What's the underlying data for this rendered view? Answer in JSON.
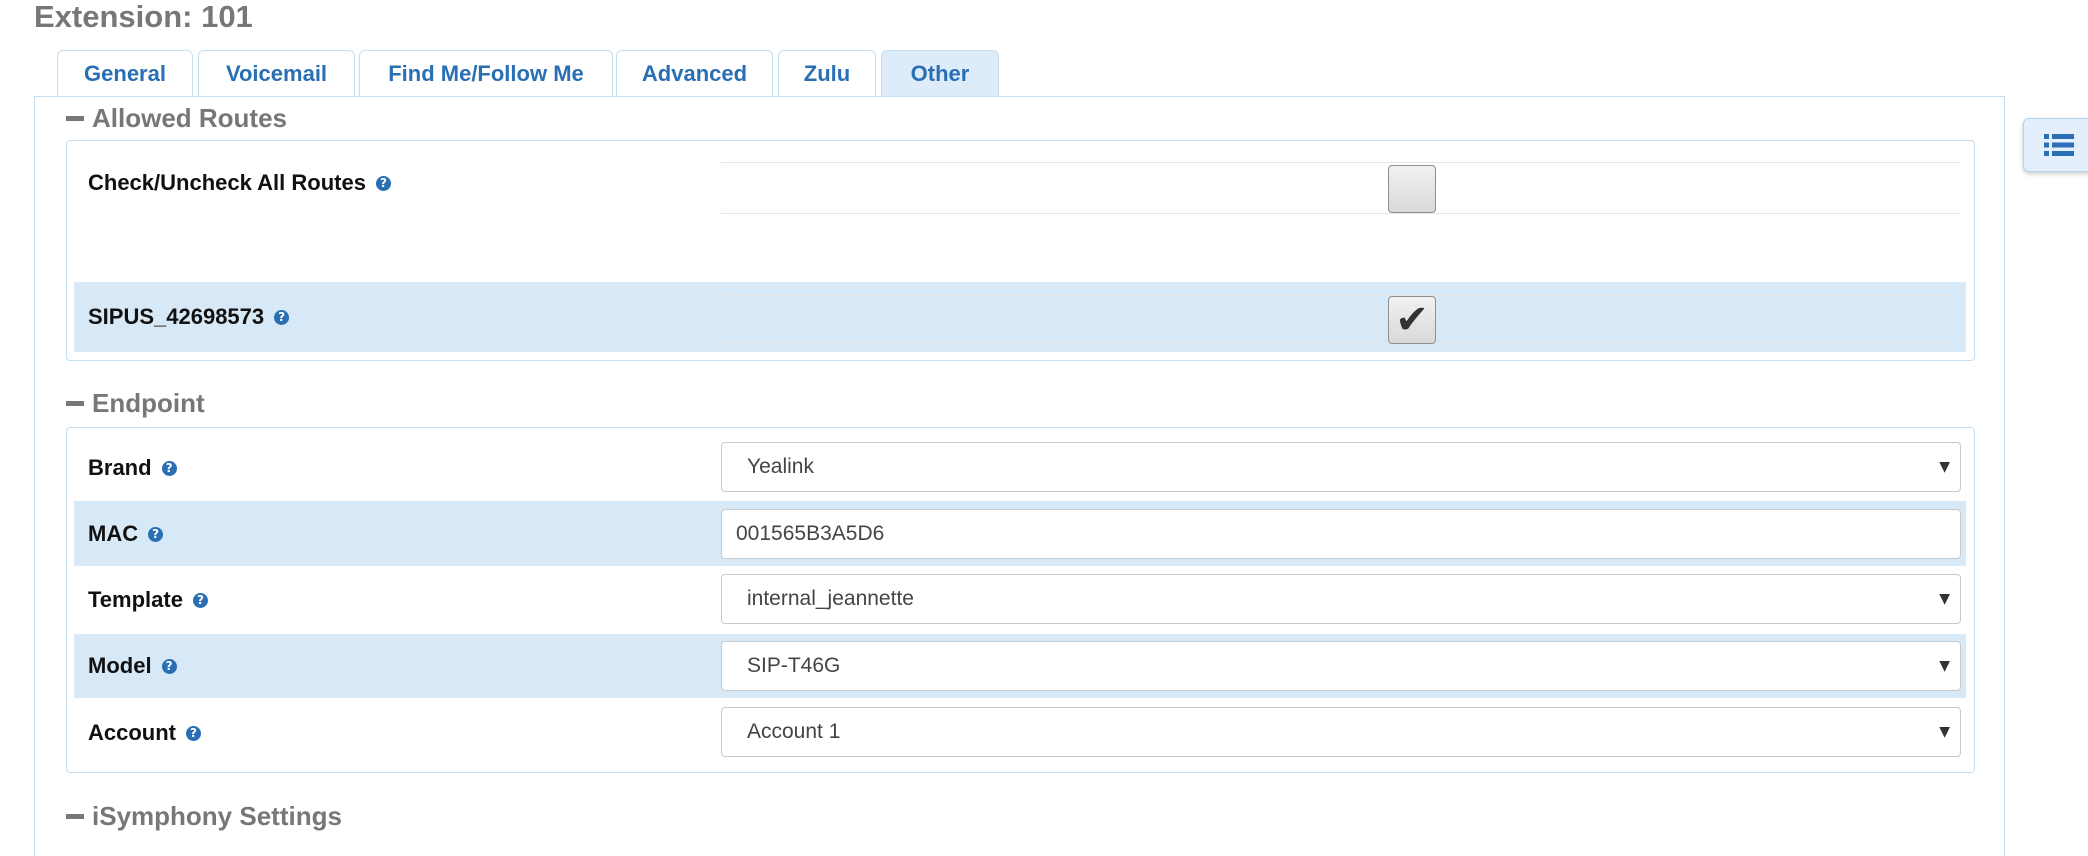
{
  "page_title": "Extension: 101",
  "tabs": [
    {
      "label": "General"
    },
    {
      "label": "Voicemail"
    },
    {
      "label": "Find Me/Follow Me"
    },
    {
      "label": "Advanced"
    },
    {
      "label": "Zulu"
    },
    {
      "label": "Other"
    }
  ],
  "active_tab": "Other",
  "sections": {
    "allowed_routes": {
      "title": "Allowed Routes",
      "rows": [
        {
          "label": "Check/Uncheck All Routes",
          "checked": false
        },
        {
          "label": "SIPUS_42698573",
          "checked": true
        }
      ]
    },
    "endpoint": {
      "title": "Endpoint",
      "brand": {
        "label": "Brand",
        "value": "Yealink"
      },
      "mac": {
        "label": "MAC",
        "value": "001565B3A5D6"
      },
      "template": {
        "label": "Template",
        "value": "internal_jeannette"
      },
      "model": {
        "label": "Model",
        "value": "SIP-T46G"
      },
      "account": {
        "label": "Account",
        "value": "Account 1"
      }
    },
    "isymphony": {
      "title": "iSymphony Settings"
    }
  },
  "icons": {
    "help": "help-circle-icon",
    "side_menu": "list-icon",
    "collapse": "minus-icon",
    "dropdown": "caret-down-icon",
    "check": "checkmark-icon"
  },
  "colors": {
    "accent": "#2a6fb4",
    "row_highlight": "#d7e9f7",
    "border": "#c5dff0",
    "section_title": "#777777"
  }
}
